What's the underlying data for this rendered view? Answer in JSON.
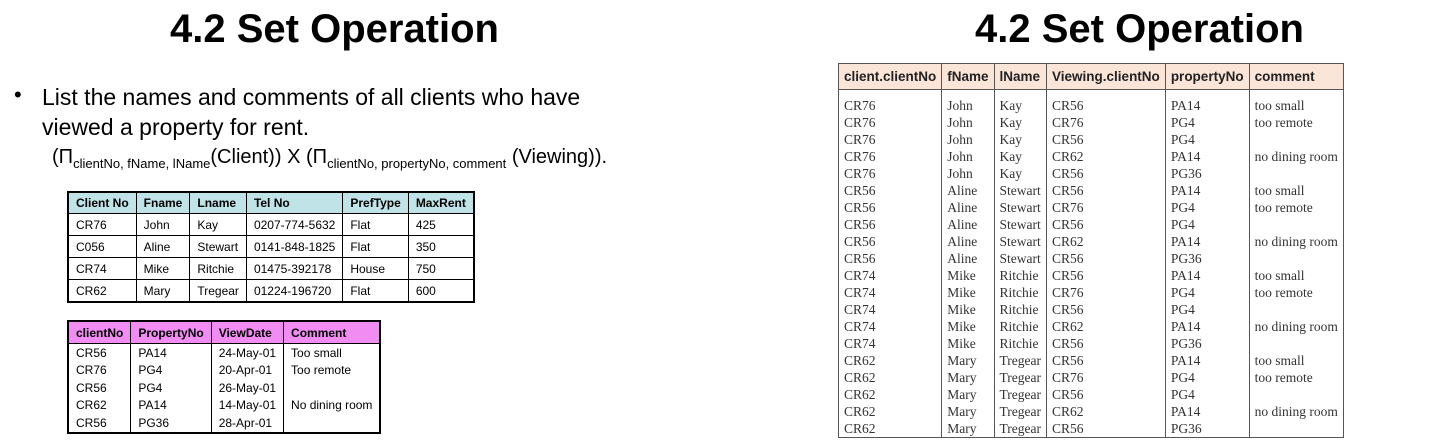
{
  "left": {
    "title": "4.2 Set Operation",
    "bullet_symbol": "•",
    "bullet_text": "List the names and comments of all clients who have viewed a property for rent.",
    "formula": {
      "p1_open": "(Π",
      "p1_sub": "clientNo, fName, lName",
      "p1_rel": "(Client))",
      "times": " X ",
      "p2_open": "(Π",
      "p2_sub": "clientNo, propertyNo, comment",
      "p2_rel": " (Viewing))."
    },
    "client_table": {
      "headers": [
        "Client No",
        "Fname",
        "Lname",
        "Tel No",
        "PrefType",
        "MaxRent"
      ],
      "rows": [
        [
          "CR76",
          "John",
          "Kay",
          "0207-774-5632",
          "Flat",
          "425"
        ],
        [
          "C056",
          "Aline",
          "Stewart",
          "0141-848-1825",
          "Flat",
          "350"
        ],
        [
          "CR74",
          "Mike",
          "Ritchie",
          "01475-392178",
          "House",
          "750"
        ],
        [
          "CR62",
          "Mary",
          "Tregear",
          "01224-196720",
          "Flat",
          "600"
        ]
      ]
    },
    "viewing_table": {
      "headers": [
        "clientNo",
        "PropertyNo",
        "ViewDate",
        "Comment"
      ],
      "rows": [
        [
          "CR56",
          "PA14",
          "24-May-01",
          "Too small"
        ],
        [
          "CR76",
          "PG4",
          "20-Apr-01",
          "Too remote"
        ],
        [
          "CR56",
          "PG4",
          "26-May-01",
          ""
        ],
        [
          "CR62",
          "PA14",
          "14-May-01",
          "No dining room"
        ],
        [
          "CR56",
          "PG36",
          "28-Apr-01",
          ""
        ]
      ]
    }
  },
  "right": {
    "title": "4.2 Set Operation",
    "result_table": {
      "headers": [
        "client.clientNo",
        "fName",
        "lName",
        "Viewing.clientNo",
        "propertyNo",
        "comment"
      ],
      "rows": [
        [
          "CR76",
          "John",
          "Kay",
          "CR56",
          "PA14",
          "too small"
        ],
        [
          "CR76",
          "John",
          "Kay",
          "CR76",
          "PG4",
          "too remote"
        ],
        [
          "CR76",
          "John",
          "Kay",
          "CR56",
          "PG4",
          ""
        ],
        [
          "CR76",
          "John",
          "Kay",
          "CR62",
          "PA14",
          "no dining room"
        ],
        [
          "CR76",
          "John",
          "Kay",
          "CR56",
          "PG36",
          ""
        ],
        [
          "CR56",
          "Aline",
          "Stewart",
          "CR56",
          "PA14",
          "too small"
        ],
        [
          "CR56",
          "Aline",
          "Stewart",
          "CR76",
          "PG4",
          "too remote"
        ],
        [
          "CR56",
          "Aline",
          "Stewart",
          "CR56",
          "PG4",
          ""
        ],
        [
          "CR56",
          "Aline",
          "Stewart",
          "CR62",
          "PA14",
          "no dining room"
        ],
        [
          "CR56",
          "Aline",
          "Stewart",
          "CR56",
          "PG36",
          ""
        ],
        [
          "CR74",
          "Mike",
          "Ritchie",
          "CR56",
          "PA14",
          "too small"
        ],
        [
          "CR74",
          "Mike",
          "Ritchie",
          "CR76",
          "PG4",
          "too remote"
        ],
        [
          "CR74",
          "Mike",
          "Ritchie",
          "CR56",
          "PG4",
          ""
        ],
        [
          "CR74",
          "Mike",
          "Ritchie",
          "CR62",
          "PA14",
          "no dining room"
        ],
        [
          "CR74",
          "Mike",
          "Ritchie",
          "CR56",
          "PG36",
          ""
        ],
        [
          "CR62",
          "Mary",
          "Tregear",
          "CR56",
          "PA14",
          "too small"
        ],
        [
          "CR62",
          "Mary",
          "Tregear",
          "CR76",
          "PG4",
          "too remote"
        ],
        [
          "CR62",
          "Mary",
          "Tregear",
          "CR56",
          "PG4",
          ""
        ],
        [
          "CR62",
          "Mary",
          "Tregear",
          "CR62",
          "PA14",
          "no dining room"
        ],
        [
          "CR62",
          "Mary",
          "Tregear",
          "CR56",
          "PG36",
          ""
        ]
      ]
    }
  }
}
